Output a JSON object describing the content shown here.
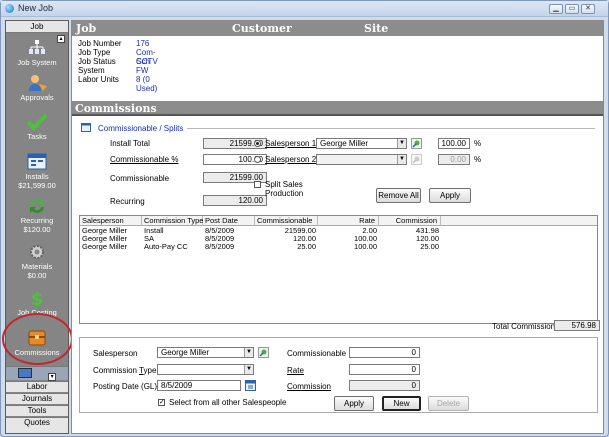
{
  "window": {
    "title": "New Job"
  },
  "sidebar": {
    "header": "Job",
    "items": [
      {
        "label": "Job System"
      },
      {
        "label": "Approvals"
      },
      {
        "label": "Tasks"
      },
      {
        "label": "Installs",
        "sub": "$21,599.00"
      },
      {
        "label": "Recurring",
        "sub": "$120.00"
      },
      {
        "label": "Materials",
        "sub": "$0.00"
      },
      {
        "label": "Job Costing"
      },
      {
        "label": "Commissions"
      }
    ],
    "tabs": [
      "Labor",
      "Journals",
      "Tools",
      "Quotes"
    ]
  },
  "header": {
    "job": "Job",
    "customer": "Customer",
    "site": "Site"
  },
  "job_info": [
    {
      "label": "Job Number",
      "value": "176"
    },
    {
      "label": "Job Type",
      "value": "Com-CCTV"
    },
    {
      "label": "Job Status",
      "value": "Sch FW"
    },
    {
      "label": "System",
      "value": ""
    },
    {
      "label": "Labor Units",
      "value": "8 (0 Used)"
    }
  ],
  "section_title": "Commissions",
  "splits": {
    "group_label": "Commissionable / Splits",
    "install_total_label": "Install Total",
    "install_total": "21599.00",
    "commissionable_pct_label": "Commissionable %",
    "commissionable_pct": "100.00",
    "commissionable_label": "Commissionable",
    "commissionable": "21599.00",
    "recurring_label": "Recurring",
    "recurring": "120.00",
    "salesperson1_label": "Salesperson 1",
    "salesperson1": "George Miller",
    "salesperson1_pct": "100.00",
    "salesperson2_label": "Salesperson 2",
    "salesperson2": "",
    "salesperson2_pct": "0.00",
    "pct_sign": "%",
    "split_sales_label": "Split Sales Production",
    "remove_all": "Remove All",
    "apply": "Apply"
  },
  "table": {
    "columns": [
      "Salesperson",
      "Commission Type",
      "Post Date",
      "Commissionable",
      "Rate",
      "Commission"
    ],
    "rows": [
      [
        "George Miller",
        "Install",
        "8/5/2009",
        "21599.00",
        "2.00",
        "431.98"
      ],
      [
        "George Miller",
        "SA",
        "8/5/2009",
        "120.00",
        "100.00",
        "120.00"
      ],
      [
        "George Miller",
        "Auto-Pay CC",
        "8/5/2009",
        "25.00",
        "100.00",
        "25.00"
      ]
    ]
  },
  "total_commission": {
    "label": "Total Commission",
    "value": "576.98"
  },
  "entry": {
    "salesperson_label": "Salesperson",
    "salesperson": "George Miller",
    "commission_type_label": "Commission Type",
    "commission_type": "",
    "posting_date_label": "Posting Date (GL)",
    "posting_date": "8/5/2009",
    "commissionable_label": "Commissionable",
    "commissionable": "0",
    "rate_label": "Rate",
    "rate": "0",
    "commission_label": "Commission",
    "commission": "0",
    "select_all_label": "Select from all other Salespeople",
    "apply": "Apply",
    "new": "New",
    "delete": "Delete"
  },
  "colors": {
    "sidebar": "#858585",
    "highlight": "#c0282e",
    "link": "#1a2db8"
  }
}
